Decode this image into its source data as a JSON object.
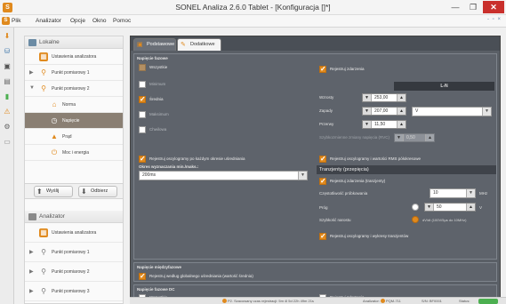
{
  "window": {
    "title": "SONEL Analiza 2.6.0 Tablet - [Konfiguracja []*]",
    "min": "—",
    "max": "❐",
    "close": "✕"
  },
  "menu": {
    "items": [
      "Plik",
      "Analizator",
      "Opcje",
      "Okno",
      "Pomoc"
    ],
    "corner": "- ▫ ×"
  },
  "tree": {
    "lokalne": "Lokalne",
    "analizator": "Analizator",
    "items_local": [
      {
        "label": "Ustawienia analizatora"
      },
      {
        "label": "Punkt pomiarowy 1"
      },
      {
        "label": "Punkt pomiarowy 2"
      },
      {
        "label": "Norma"
      },
      {
        "label": "Napięcie"
      },
      {
        "label": "Prąd"
      },
      {
        "label": "Moc i energia"
      }
    ],
    "items_remote": [
      {
        "label": "Ustawienia analizatora"
      },
      {
        "label": "Punkt pomiarowy 1"
      },
      {
        "label": "Punkt pomiarowy 2"
      },
      {
        "label": "Punkt pomiarowy 3"
      }
    ],
    "send_label": "Wyślij",
    "receive_label": "Odbierz"
  },
  "tabs": [
    {
      "label": "Podstawowe"
    },
    {
      "label": "Dodatkowe"
    }
  ],
  "phase_voltage": {
    "title": "Napięcie fazowe",
    "all": "Wszystkie",
    "minimum": "Minimum",
    "mean": "Średnia",
    "maximum": "Maksimum",
    "instant": "Chwilowa",
    "record_events": "Rejestruj zdarzenia",
    "column": "L-N",
    "swells": "Wzrosty",
    "swells_value": "253,00",
    "dips": "Zapady",
    "dips_value": "207,00",
    "unit_v": "V",
    "interruptions": "Przerwy",
    "interruptions_value": "11,50",
    "rapid": "Szybkozmienne zmiany napięcia (RVC)",
    "rapid_value": "0,50",
    "osc_each": "Rejestruj oscylogramy po każdym okresie uśredniania",
    "period_label": "Okres wyznaczania min./maks.:",
    "period_value": "200ms",
    "osc_rms": "Rejestruj oscylogramy i wartości RMS półokresowe"
  },
  "transients": {
    "header": "Tranzjenty (przepięcia)",
    "record": "Rejestruj zdarzenia (tranzjenty)",
    "sampling": "Częstotliwość próbkowania",
    "sampling_value": "10",
    "sampling_unit": "MHz",
    "threshold": "Próg",
    "threshold_value": "50",
    "threshold_unit": "V",
    "rate": "Szybkość narostu",
    "rate_option": "dV/dt (100V/5µs do 10MHz)",
    "osc": "Rejestruj oscylogramy i wykresy tranzjentów"
  },
  "line_voltage": {
    "title": "Napięcie międzyfazowe",
    "register": "Rejestruj według globalnego uśredniania (wartość średnia)"
  },
  "dc_voltage": {
    "title": "Napięcie fazowe DC",
    "all": "Wszystkie",
    "minimum": "Minimum",
    "record_events": "Rejestruj zdarzenia"
  },
  "status": {
    "estimate": "P2. Szacowany czas rejestracji: 5m 4l 5d 22h 49m 21s",
    "analyzer": "Analizator: ",
    "model": "PQM-711",
    "serial": "S/N: BF0001",
    "status": "Status:"
  },
  "colors": {
    "accent": "#e08a1e",
    "close": "#c9302c",
    "panel": "#5a5f66",
    "selected": "#8a7f73",
    "status_ok": "#4caf50"
  }
}
